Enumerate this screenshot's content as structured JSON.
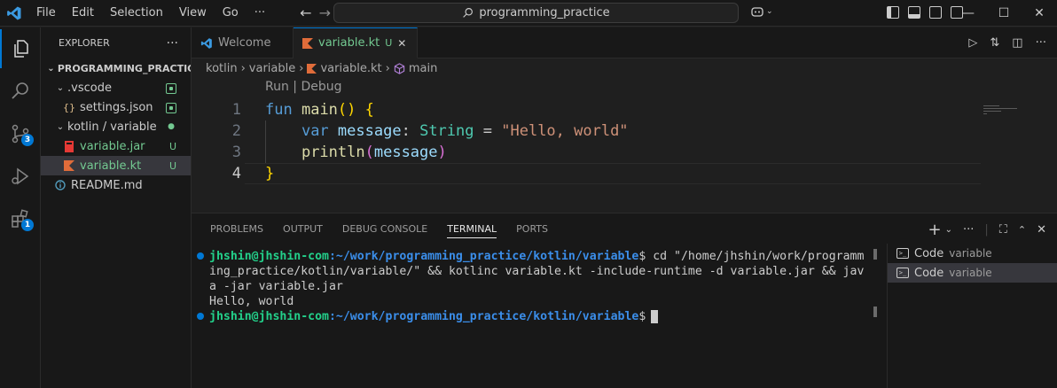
{
  "titlebar": {
    "menu": [
      "File",
      "Edit",
      "Selection",
      "View",
      "Go",
      "···"
    ],
    "search": "programming_practice"
  },
  "activity": {
    "scm_badge": "3",
    "ext_badge": "1"
  },
  "explorer": {
    "title": "EXPLORER",
    "more": "···",
    "root": "PROGRAMMING_PRACTICE",
    "items": [
      {
        "label": ".vscode"
      },
      {
        "label": "settings.json",
        "icon": "{}"
      },
      {
        "label": "kotlin / variable"
      },
      {
        "label": "variable.jar",
        "status": "U"
      },
      {
        "label": "variable.kt",
        "status": "U"
      },
      {
        "label": "README.md"
      }
    ]
  },
  "editor": {
    "tabs": [
      {
        "label": "Welcome"
      },
      {
        "label": "variable.kt",
        "status": "U"
      }
    ],
    "breadcrumb": [
      "kotlin",
      "variable",
      "variable.kt",
      "main"
    ],
    "codelens": "Run | Debug",
    "line_numbers": [
      "1",
      "2",
      "3",
      "4"
    ]
  },
  "panel": {
    "tabs": [
      "PROBLEMS",
      "OUTPUT",
      "DEBUG CONSOLE",
      "TERMINAL",
      "PORTS"
    ],
    "terminal": {
      "user": "jhshin@jhshin-com",
      "path": ":~/work/programming_practice/kotlin/variable",
      "cmd_line1": "$ cd \"/home/jhshin/work/programm",
      "cmd_line2": "ing_practice/kotlin/variable/\" && kotlinc variable.kt -include-runtime -d variable.jar && jav",
      "cmd_line3": "a -jar variable.jar",
      "output": "Hello, world",
      "prompt_end": "$"
    },
    "terminals": [
      {
        "name": "Code",
        "sub": "variable"
      },
      {
        "name": "Code",
        "sub": "variable"
      }
    ]
  }
}
